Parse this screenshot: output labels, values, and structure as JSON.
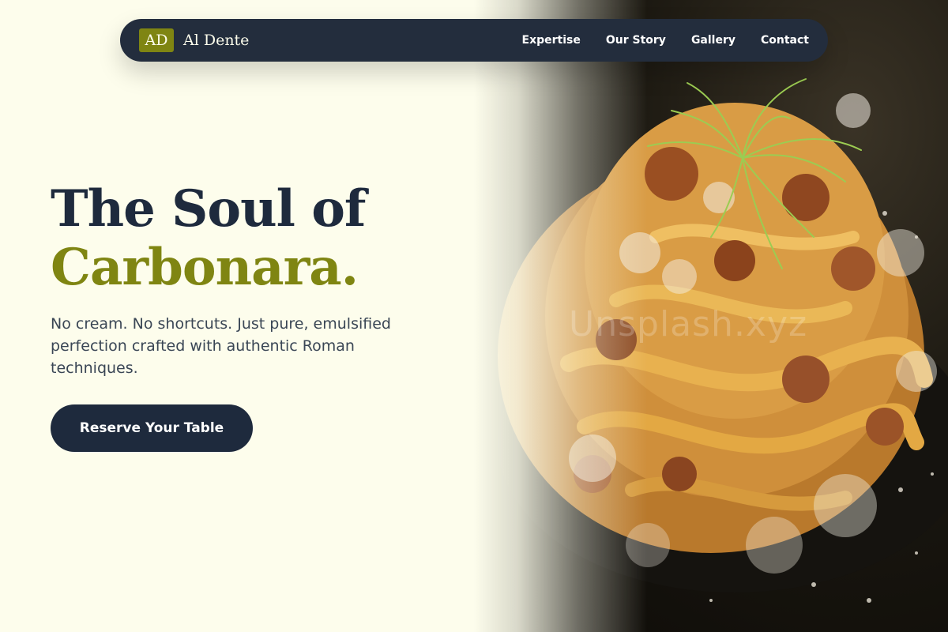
{
  "brand": {
    "badge": "AD",
    "name": "Al Dente"
  },
  "nav": {
    "links": [
      "Expertise",
      "Our Story",
      "Gallery",
      "Contact"
    ]
  },
  "hero": {
    "headline_line1": "The Soul of",
    "headline_line2": "Carbonara.",
    "subtext": "No cream. No shortcuts. Just pure, emulsified perfection crafted with authentic Roman techniques.",
    "cta_label": "Reserve Your Table",
    "image_watermark": "Unsplash.xyz"
  },
  "colors": {
    "background": "#fdfdec",
    "navy": "#1e2a3d",
    "olive_accent": "#7f8512",
    "body_text": "#3a4655"
  },
  "icons": {
    "hero_image": "pasta-dish-photo"
  }
}
